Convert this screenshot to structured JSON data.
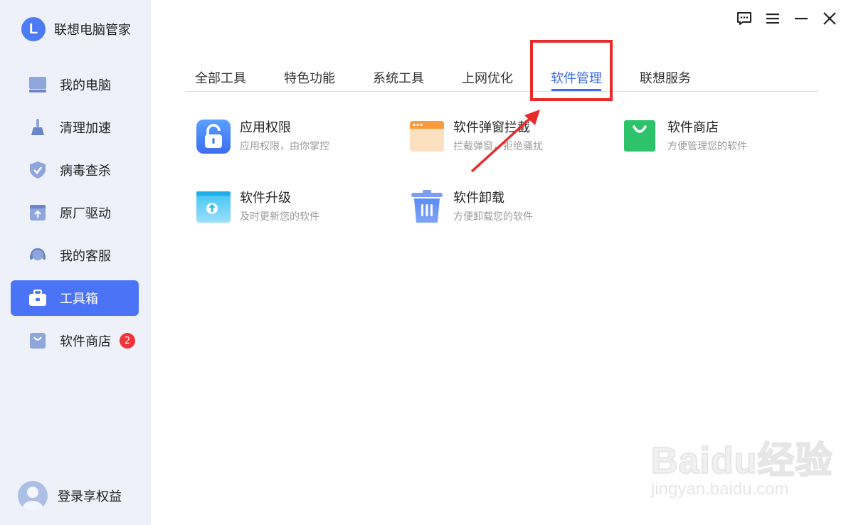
{
  "app": {
    "name": "联想电脑管家",
    "logo_letter": "L"
  },
  "sidebar": {
    "items": [
      {
        "label": "我的电脑",
        "icon": "laptop-icon"
      },
      {
        "label": "清理加速",
        "icon": "broom-icon"
      },
      {
        "label": "病毒查杀",
        "icon": "shield-icon"
      },
      {
        "label": "原厂驱动",
        "icon": "driver-upload-icon"
      },
      {
        "label": "我的客服",
        "icon": "headset-icon"
      },
      {
        "label": "工具箱",
        "icon": "toolbox-icon",
        "active": true
      },
      {
        "label": "软件商店",
        "icon": "store-bag-icon",
        "badge": "2"
      }
    ],
    "login_label": "登录享权益"
  },
  "titlebar": {
    "icons": [
      "feedback-icon",
      "menu-icon",
      "minimize-icon",
      "close-icon"
    ]
  },
  "tabs": [
    {
      "label": "全部工具"
    },
    {
      "label": "特色功能"
    },
    {
      "label": "系统工具"
    },
    {
      "label": "上网优化"
    },
    {
      "label": "软件管理",
      "active": true
    },
    {
      "label": "联想服务"
    }
  ],
  "tools": [
    {
      "title": "应用权限",
      "desc": "应用权限，由你掌控",
      "icon": "lock-icon"
    },
    {
      "title": "软件弹窗拦截",
      "desc": "拦截弹窗，拒绝骚扰",
      "icon": "popup-window-icon"
    },
    {
      "title": "软件商店",
      "desc": "方便管理您的软件",
      "icon": "shopping-bag-icon"
    },
    {
      "title": "软件升级",
      "desc": "及时更新您的软件",
      "icon": "upgrade-icon"
    },
    {
      "title": "软件卸载",
      "desc": "方便卸载您的软件",
      "icon": "trash-icon"
    }
  ],
  "colors": {
    "accent": "#4b73f5",
    "highlight": "#e82a2a",
    "badge": "#f0343a"
  },
  "watermark": {
    "logo": "Baidu经验",
    "url": "jingyan.baidu.com"
  }
}
